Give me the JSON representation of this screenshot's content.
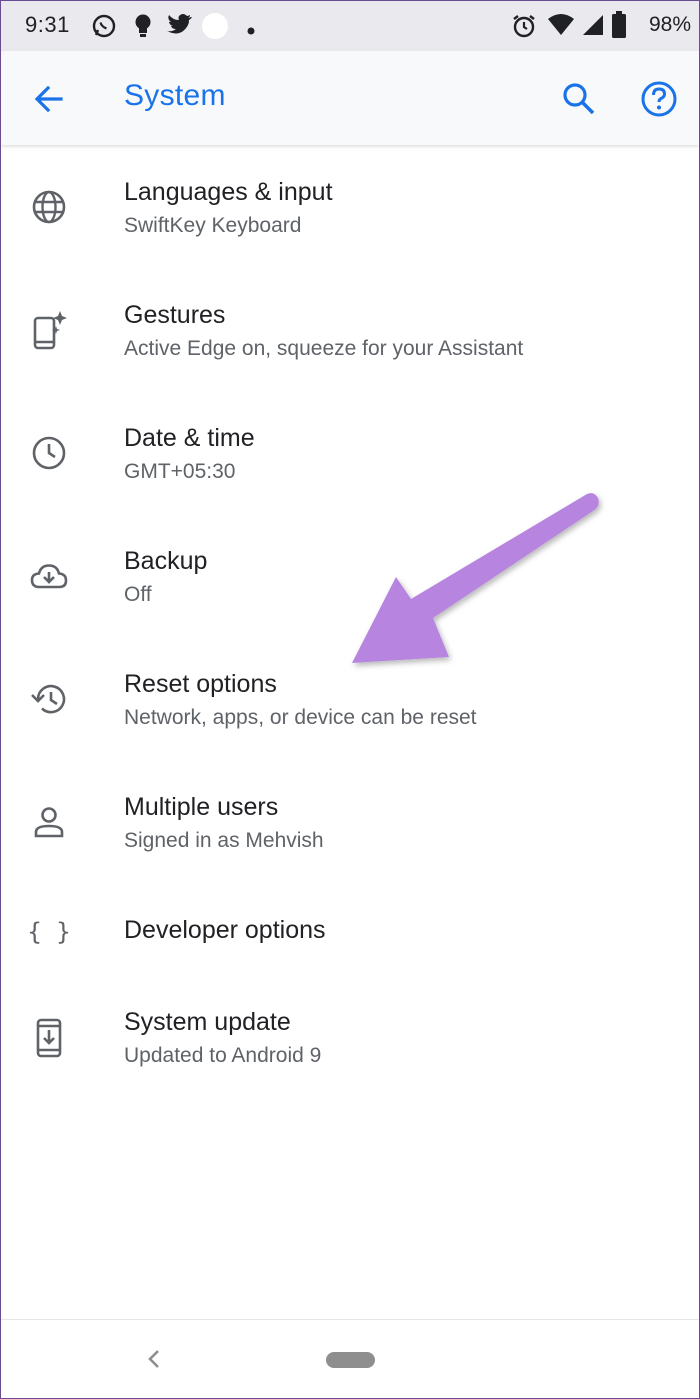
{
  "status_bar": {
    "time": "9:31",
    "battery": "98%",
    "icons": [
      "whatsapp-icon",
      "lightbulb-icon",
      "twitter-icon",
      "circle-icon",
      "dot-icon",
      "alarm-icon",
      "wifi-icon",
      "signal-icon",
      "battery-icon"
    ]
  },
  "app_bar": {
    "title": "System",
    "accent_color": "#1a73e8"
  },
  "settings": [
    {
      "icon": "globe-icon",
      "title": "Languages & input",
      "subtitle": "SwiftKey Keyboard"
    },
    {
      "icon": "gestures-icon",
      "title": "Gestures",
      "subtitle": "Active Edge on, squeeze for your Assistant"
    },
    {
      "icon": "clock-icon",
      "title": "Date & time",
      "subtitle": "GMT+05:30"
    },
    {
      "icon": "cloud-backup-icon",
      "title": "Backup",
      "subtitle": "Off"
    },
    {
      "icon": "history-icon",
      "title": "Reset options",
      "subtitle": "Network, apps, or device can be reset"
    },
    {
      "icon": "person-icon",
      "title": "Multiple users",
      "subtitle": "Signed in as Mehvish"
    },
    {
      "icon": "braces-icon",
      "title": "Developer options",
      "icon_text": "{ }"
    },
    {
      "icon": "system-update-icon",
      "title": "System update",
      "subtitle": "Updated to Android 9"
    }
  ],
  "annotation": {
    "arrow_color": "#b784e0"
  }
}
